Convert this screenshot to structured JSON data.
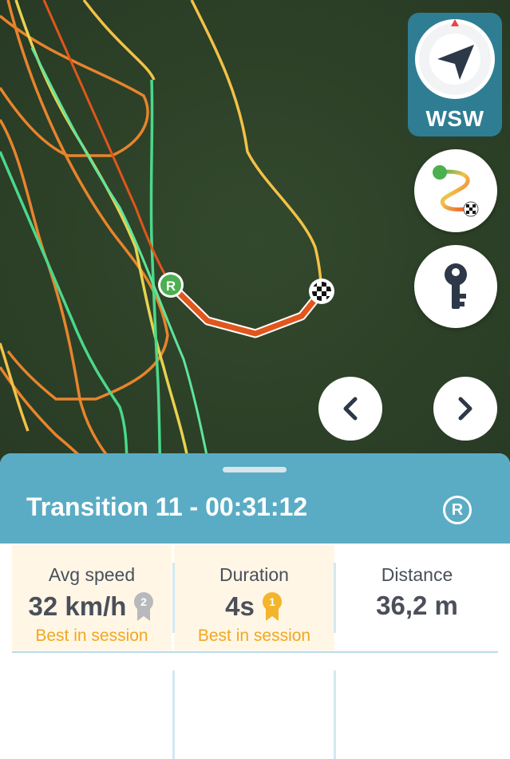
{
  "compass": {
    "direction": "WSW"
  },
  "map": {
    "start_marker_label": "R",
    "buttons": [
      "track-replay",
      "key",
      "previous",
      "next"
    ]
  },
  "sheet": {
    "title": "Transition 11 - 00:31:12",
    "badge": "R"
  },
  "stats": [
    {
      "label": "Avg speed",
      "value": "32 km/h",
      "medal_rank": "2",
      "note": "Best in session"
    },
    {
      "label": "Duration",
      "value": "4s",
      "medal_rank": "1",
      "note": "Best in session"
    },
    {
      "label": "Distance",
      "value": "36,2 m"
    }
  ],
  "colors": {
    "map_background": "#2f4429",
    "header": "#5aacc5",
    "compass_card": "#2f7d93",
    "highlight": "#f0a81e",
    "segment": "#e0561c",
    "silver_medal": "#b8b9bd",
    "gold_medal": "#f3b52b"
  }
}
